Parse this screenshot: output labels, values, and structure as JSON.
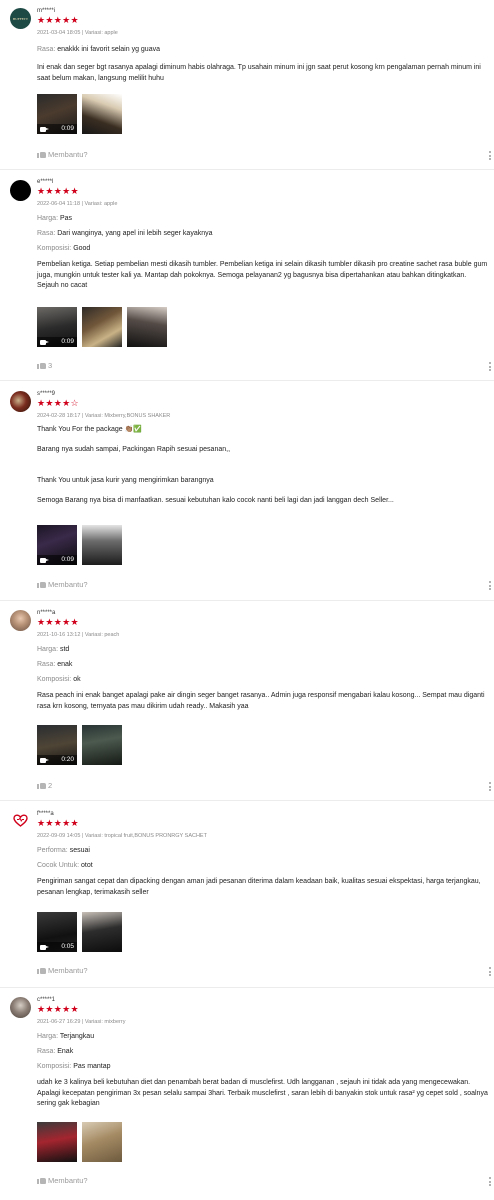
{
  "reviews": [
    {
      "username": "m*****i",
      "stars": "★★★★★",
      "meta": "2021-03-04 18:05 | Variasi: apple",
      "attrs": [
        {
          "k": "Rasa:",
          "v": "enakkk ini favorit selain yg guava"
        }
      ],
      "body": [
        "Ini enak dan seger bgt rasanya apalagi diminum habis olahraga. Tp usahain minum ini jgn saat perut kosong krn pengalaman pernah minum ini saat belum makan, langsung melilit huhu"
      ],
      "video_duration": "0:09",
      "helpful": "Membantu?",
      "avatar_text": "BUFFETT"
    },
    {
      "username": "e*****l",
      "stars": "★★★★★",
      "meta": "2022-06-04 11:18 | Variasi: apple",
      "attrs": [
        {
          "k": "Harga:",
          "v": "Pas"
        },
        {
          "k": "Rasa:",
          "v": "Dari wanginya, yang apel ini lebih seger kayaknya"
        },
        {
          "k": "Komposisi:",
          "v": "Good"
        }
      ],
      "body": [
        "Pembelian ketiga. Setiap pembelian mesti dikasih tumbler. Pembelian ketiga ini selain dikasih tumbler dikasih pro creatine sachet rasa buble gum juga, mungkin untuk tester kali ya. Mantap dah pokoknya. Semoga pelayanan2 yg bagusnya bisa dipertahankan atau bahkan ditingkatkan. Sejauh no cacat"
      ],
      "video_duration": "0:09",
      "helpful": "3"
    },
    {
      "username": "s*****9",
      "stars": "★★★★",
      "stars_off": "☆",
      "meta": "2024-02-28 18:17 | Variasi: Mixberry,BONUS SHAKER",
      "attrs": [],
      "body": [
        "Thank You For the package 👏🏽✅",
        "Barang nya sudah sampai, Packingan Rapih sesuai pesanan,,",
        "Thank You untuk jasa kurir yang mengirimkan barangnya",
        "Semoga Barang nya bisa di manfaatkan. sesuai kebutuhan kalo cocok nanti beli lagi dan jadi langgan dech Seller..."
      ],
      "video_duration": "0:09",
      "helpful": "Membantu?"
    },
    {
      "username": "n*****a",
      "stars": "★★★★★",
      "meta": "2021-10-16 13:12 | Variasi: peach",
      "attrs": [
        {
          "k": "Harga:",
          "v": "std"
        },
        {
          "k": "Rasa:",
          "v": "enak"
        },
        {
          "k": "Komposisi:",
          "v": "ok"
        }
      ],
      "body": [
        "Rasa peach ini enak banget apalagi pake air dingin seger banget rasanya.. Admin juga responsif mengabari kalau kosong... Sempat mau diganti rasa krn kosong, ternyata pas mau dikirim udah ready.. Makasih yaa"
      ],
      "video_duration": "0:20",
      "helpful": "2"
    },
    {
      "username": "f*****a",
      "stars": "★★★★★",
      "meta": "2022-09-09 14:05 | Variasi: tropical fruit,BONUS PRONRGY SACHET",
      "attrs": [
        {
          "k": "Performa:",
          "v": "sesuai"
        },
        {
          "k": "Cocok Untuk:",
          "v": "otot"
        }
      ],
      "body": [
        "Pengiriman sangat cepat dan dipacking dengan aman jadi pesanan diterima dalam keadaan baik, kualitas sesuai ekspektasi, harga terjangkau, pesanan lengkap, terimakasih seller"
      ],
      "video_duration": "0:05",
      "helpful": "Membantu?"
    },
    {
      "username": "c*****1",
      "stars": "★★★★★",
      "meta": "2021-06-27 16:29 | Variasi: mixberry",
      "attrs": [
        {
          "k": "Harga:",
          "v": "Terjangkau"
        },
        {
          "k": "Rasa:",
          "v": "Enak"
        },
        {
          "k": "Komposisi:",
          "v": "Pas mantap"
        }
      ],
      "body": [
        "udah ke 3 kalinya beli kebutuhan diet dan penambah berat badan di musclefirst. Udh langganan , sejauh ini tidak ada yang mengecewakan. Apalagi kecepatan pengiriman 3x pesan selalu sampai 3hari. Terbaik musclefirst , saran lebih di banyakin stok untuk rasa² yg cepet sold , soalnya sering gak kebagian"
      ],
      "video_duration": "",
      "helpful": "Membantu?"
    }
  ],
  "colors": {
    "star": "#d0011b",
    "muted": "#8a8a8a",
    "text": "#222222"
  }
}
